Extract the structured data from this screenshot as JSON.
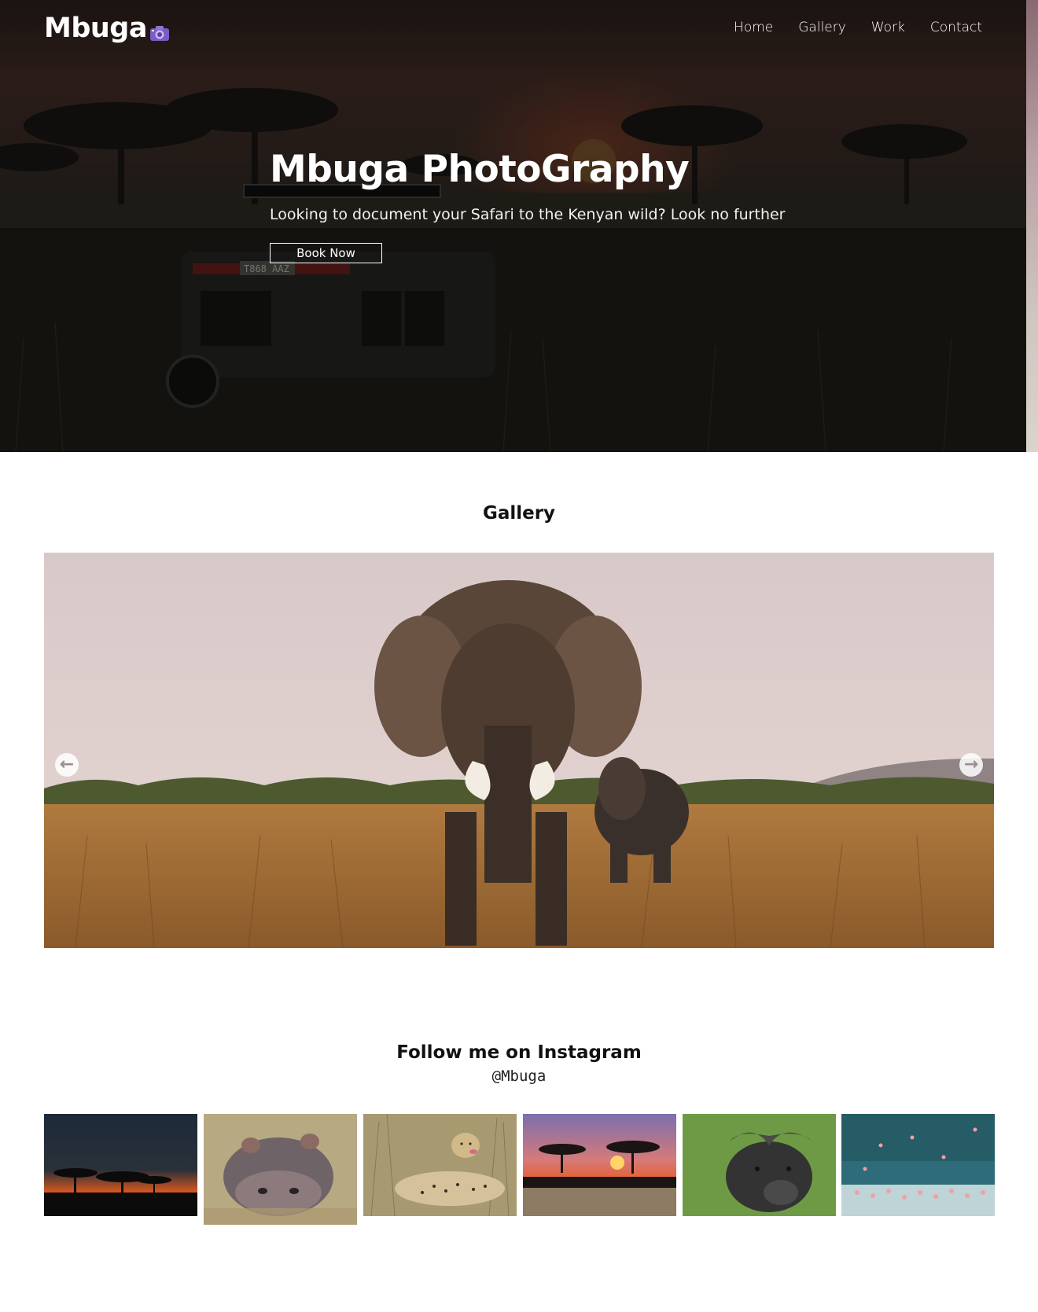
{
  "header": {
    "brand": "Mbuga",
    "brand_icon": "camera-icon",
    "nav": [
      {
        "label": "Home"
      },
      {
        "label": "Gallery"
      },
      {
        "label": "Work"
      },
      {
        "label": "Contact"
      }
    ]
  },
  "hero": {
    "title": "Mbuga PhotoGraphy",
    "subtitle": "Looking to document your Safari to the Kenyan wild? Look no further",
    "cta_label": "Book Now",
    "vehicle_plate": "T868 AAZ"
  },
  "gallery": {
    "title": "Gallery",
    "prev_icon": "arrow-left-circle-icon",
    "next_icon": "arrow-right-circle-icon"
  },
  "instagram": {
    "title": "Follow me on Instagram",
    "handle": "@Mbuga"
  },
  "colors": {
    "accent_icon": "#7c5cc4",
    "hero_bg": "#1c1b18",
    "text_dark": "#111111"
  }
}
